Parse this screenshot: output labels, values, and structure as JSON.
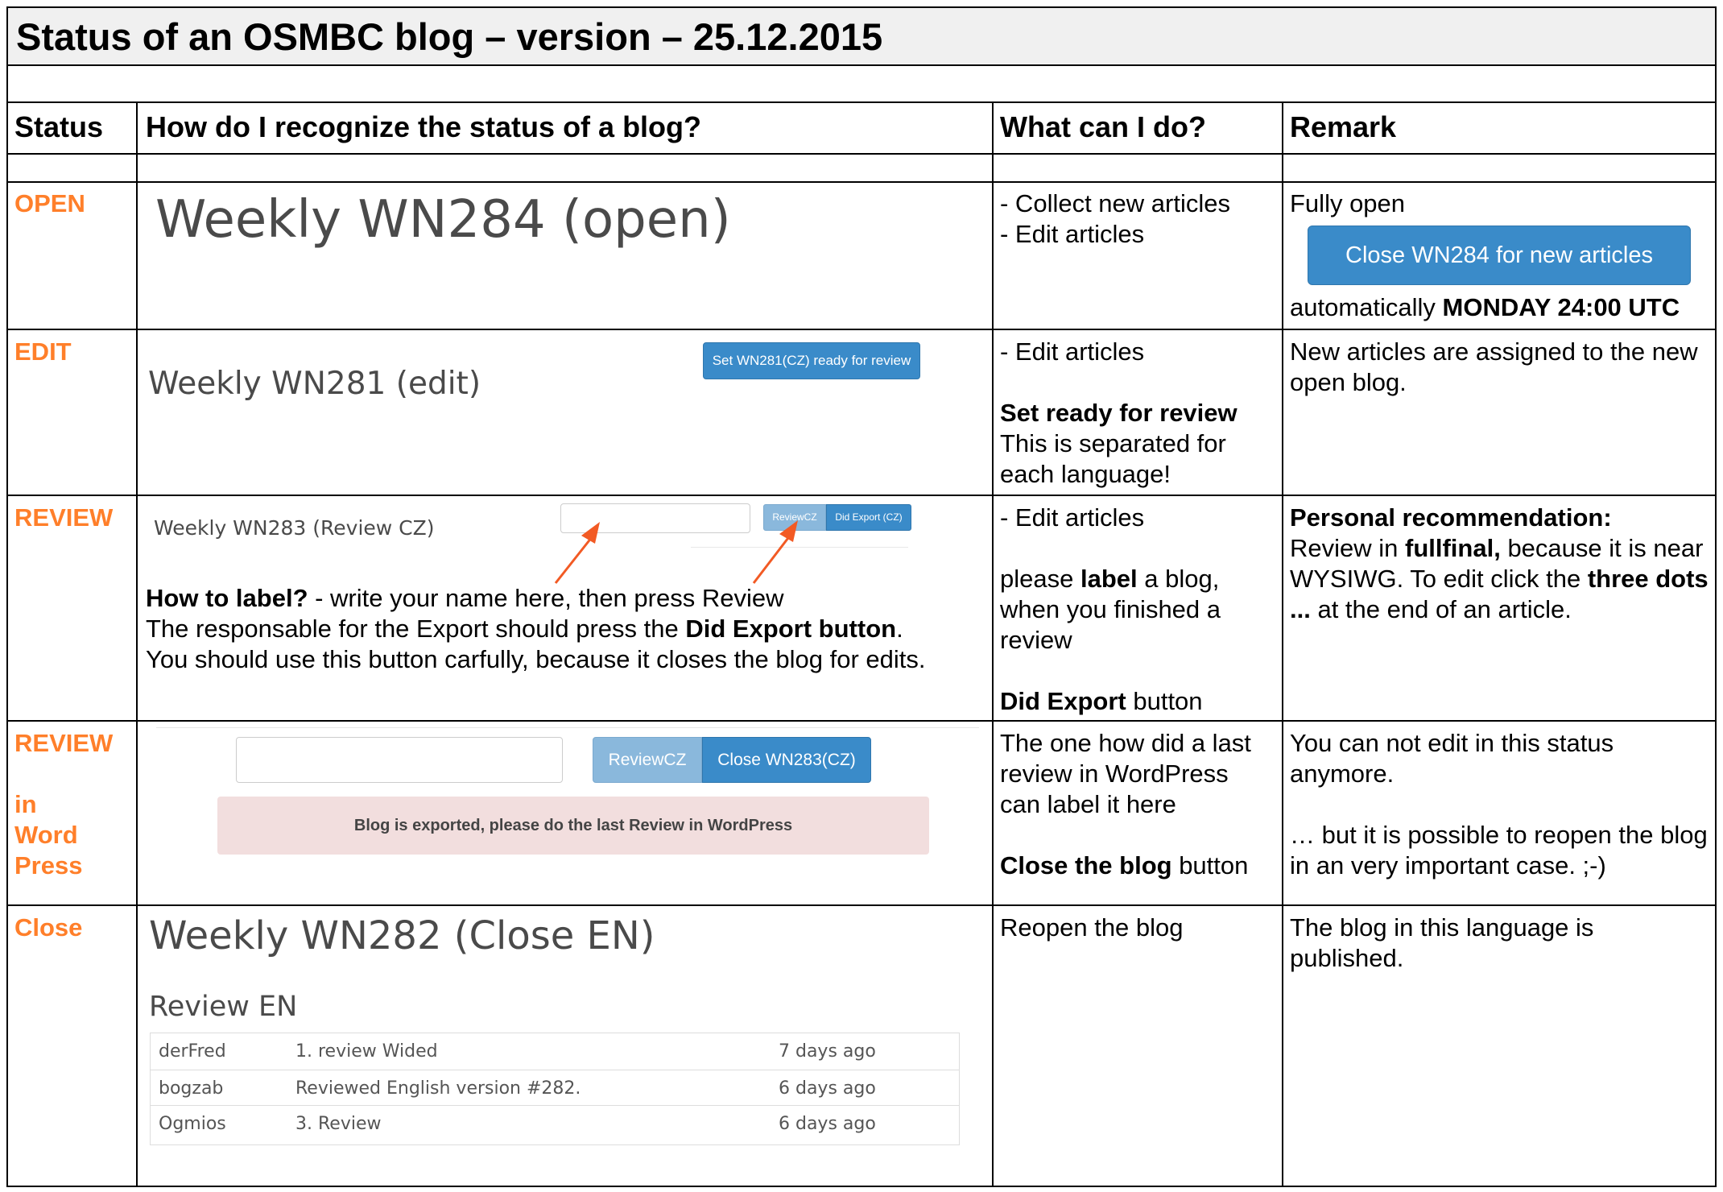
{
  "title": "Status of an OSMBC blog – version – 25.12.2015",
  "columns": {
    "status": "Status",
    "recognize": "How do I recognize the status of a blog?",
    "what": "What can I do?",
    "remark": "Remark"
  },
  "open": {
    "status": "OPEN",
    "heading": "Weekly WN284 (open)",
    "what_lines": [
      "- Collect new articles",
      "- Edit articles"
    ],
    "remark_fully": "Fully open",
    "close_button": "Close WN284 for new articles",
    "remark_auto_prefix": "automatically ",
    "remark_auto_bold": "MONDAY 24:00 UTC"
  },
  "edit": {
    "status": "EDIT",
    "heading": "Weekly WN281 (edit)",
    "ready_button": "Set WN281(CZ) ready for review",
    "what_line1": "- Edit articles",
    "what_bold": "Set ready for review",
    "what_rest": "This is separated for each language!",
    "remark": "New articles are assigned to the new open blog."
  },
  "review": {
    "status": "REVIEW",
    "heading": "Weekly WN283 (Review CZ)",
    "review_button": "ReviewCZ",
    "export_button": "Did Export (CZ)",
    "howto_bold": "How to label?",
    "howto_rest": " - write your name here, then press Review",
    "export_line_prefix": "The responsable for the Export should press the ",
    "export_line_bold": "Did Export button",
    "export_line_suffix": ".",
    "careful_line": "You should use this button carfully, because it closes the blog for edits.",
    "what_line1": "- Edit articles",
    "what_label_prefix": "please ",
    "what_label_bold": "label",
    "what_label_suffix": " a blog, when you finished a review",
    "what_export_bold": "Did Export",
    "what_export_suffix": " button",
    "remark_bold": "Personal recommendation:",
    "remark_p1": "Review in ",
    "remark_b1": "fullfinal,",
    "remark_p2": " because it is near WYSIWG. To edit click the ",
    "remark_b2": "three dots ...",
    "remark_p3": " at the end of an article."
  },
  "wordpress": {
    "status_lines": [
      "REVIEW",
      "",
      "in",
      "Word",
      "Press"
    ],
    "review_button": "ReviewCZ",
    "close_button": "Close WN283(CZ)",
    "alert": "Blog is exported, please do the last Review in WordPress",
    "what_text": "The one how did a last review in WordPress can label it here",
    "what_bold": "Close the blog",
    "what_suffix": " button",
    "remark1": "You can not edit in this status anymore.",
    "remark2": "… but it is possible to reopen the blog in an very important case. ;-)"
  },
  "close": {
    "status": "Close",
    "heading": "Weekly WN282 (Close EN)",
    "subheading": "Review EN",
    "reviews": [
      {
        "user": "derFred",
        "comment": "1. review Wided",
        "when": "7 days ago"
      },
      {
        "user": "bogzab",
        "comment": "Reviewed English version #282.",
        "when": "6 days ago"
      },
      {
        "user": "Ogmios",
        "comment": "3. Review",
        "when": "6 days ago"
      }
    ],
    "what": "Reopen the blog",
    "remark": "The blog in this language is published."
  },
  "colors": {
    "status": "#ff7f2a",
    "button": "#3a8bc9",
    "button_light": "#8ab8dc",
    "alert_bg": "#f2dede",
    "title_bg": "#f0f0f0"
  }
}
